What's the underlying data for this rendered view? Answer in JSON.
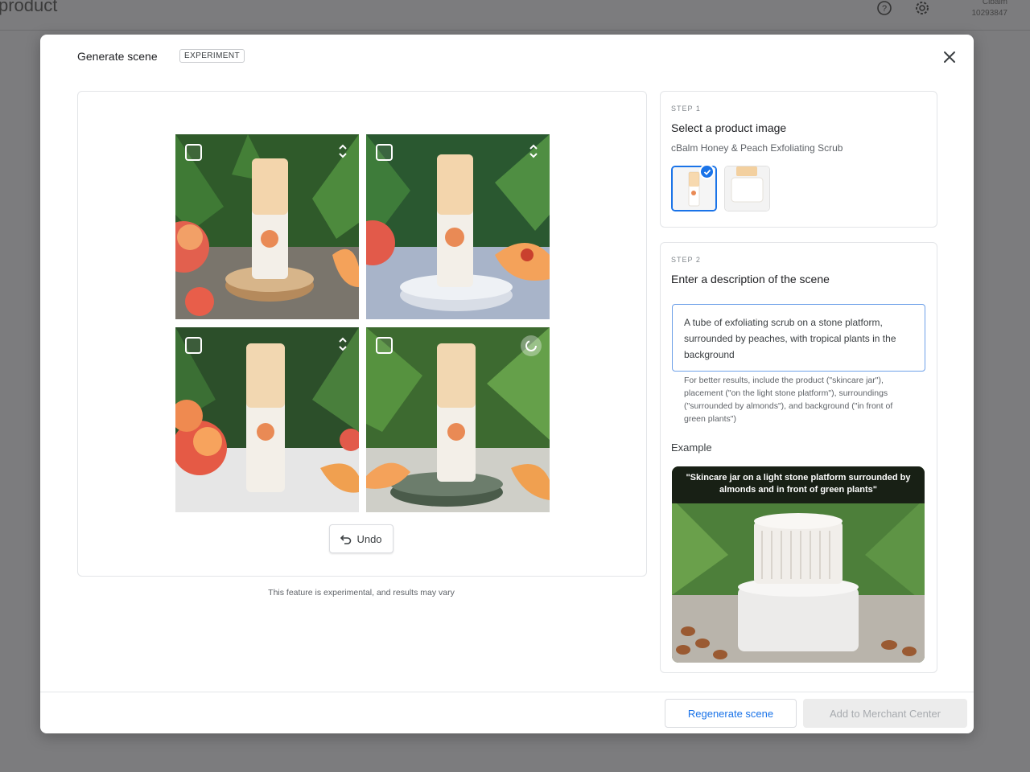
{
  "background": {
    "page_title": "product",
    "account_name": "Cibalm",
    "account_id": "10293847"
  },
  "dialog": {
    "title": "Generate scene",
    "badge": "EXPERIMENT",
    "undo_label": "Undo",
    "disclaimer": "This feature is experimental, and results may vary"
  },
  "step1": {
    "label": "STEP 1",
    "title": "Select a product image",
    "product_name": "cBalm Honey & Peach Exfoliating Scrub"
  },
  "step2": {
    "label": "STEP 2",
    "title": "Enter a description of the scene",
    "description": "A tube of exfoliating scrub on a stone platform, surrounded by peaches, with tropical plants in the background",
    "hint": "For better results, include the product (\"skincare jar\"), placement (\"on the light stone platform\"), surroundings (\"surrounded by almonds\"), and background (\"in front of green plants\")",
    "example_label": "Example",
    "example_caption": "\"Skincare jar on a light stone platform surrounded by almonds and in front of green plants\""
  },
  "footer": {
    "regenerate_label": "Regenerate scene",
    "add_label": "Add to Merchant Center"
  },
  "product_brand": "cBalm",
  "colors": {
    "accent": "#1a73e8",
    "disabled_bg": "#ececec",
    "disabled_text": "#a8abaf"
  }
}
